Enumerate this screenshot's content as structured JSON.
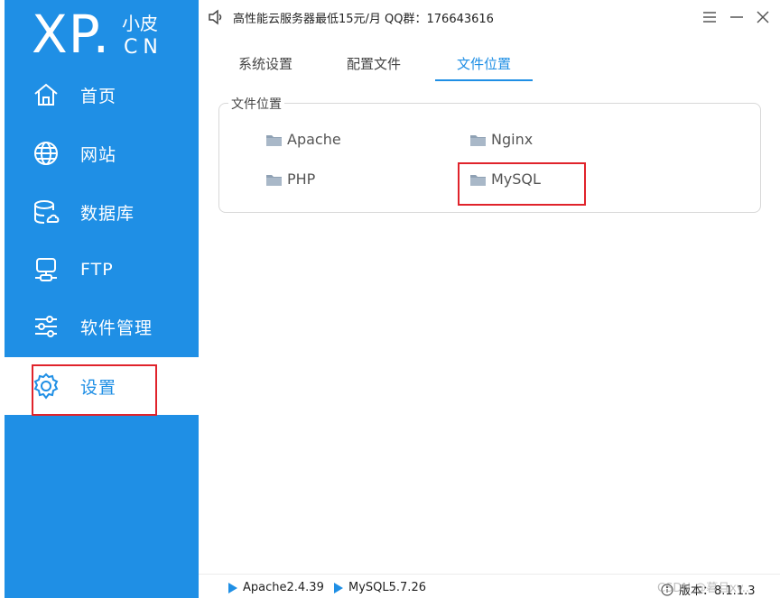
{
  "brand": {
    "logo_main": "XP.",
    "logo_cn_top": "小皮",
    "logo_cn_bottom": "CN"
  },
  "sidebar": {
    "items": [
      {
        "label": "首页",
        "icon": "home-icon"
      },
      {
        "label": "网站",
        "icon": "globe-icon"
      },
      {
        "label": "数据库",
        "icon": "database-icon"
      },
      {
        "label": "FTP",
        "icon": "ftp-icon"
      },
      {
        "label": "软件管理",
        "icon": "sliders-icon"
      },
      {
        "label": "设置",
        "icon": "gear-icon",
        "active": true
      }
    ]
  },
  "topbar": {
    "notice": "高性能云服务器最低15元/月   QQ群：176643616"
  },
  "tabs": [
    {
      "label": "系统设置"
    },
    {
      "label": "配置文件"
    },
    {
      "label": "文件位置",
      "active": true
    }
  ],
  "file_location": {
    "group_title": "文件位置",
    "folders": [
      "Apache",
      "Nginx",
      "PHP",
      "MySQL"
    ]
  },
  "statusbar": {
    "services": [
      "Apache2.4.39",
      "MySQL5.7.26"
    ],
    "version": "版本：8.1.1.3",
    "watermark": "CSDN @暮且xy.."
  },
  "colors": {
    "accent": "#1f8fe5",
    "highlight": "#e0232b",
    "sidebar_bg": "#1f8fe5"
  }
}
